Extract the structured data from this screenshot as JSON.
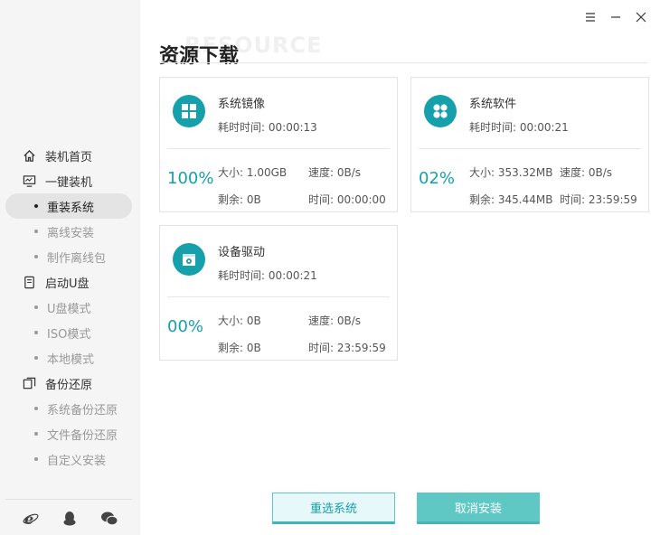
{
  "window": {
    "controls": [
      "menu",
      "minimize",
      "close"
    ]
  },
  "header": {
    "background_word": "RESOURCE",
    "title": "资源下载"
  },
  "sidebar": {
    "groups": [
      {
        "label": "装机首页",
        "icon": "home-icon",
        "items": []
      },
      {
        "label": "一键装机",
        "icon": "monitor-icon",
        "items": [
          {
            "label": "重装系统",
            "active": true
          },
          {
            "label": "离线安装"
          },
          {
            "label": "制作离线包"
          }
        ]
      },
      {
        "label": "启动U盘",
        "icon": "usb-drive-icon",
        "items": [
          {
            "label": "U盘模式"
          },
          {
            "label": "ISO模式"
          },
          {
            "label": "本地模式"
          }
        ]
      },
      {
        "label": "备份还原",
        "icon": "backup-icon",
        "items": [
          {
            "label": "系统备份还原"
          },
          {
            "label": "文件备份还原"
          },
          {
            "label": "自定义安装"
          }
        ]
      }
    ],
    "footer_icons": [
      "ie-browser-icon",
      "qq-penguin-icon",
      "wechat-icon"
    ]
  },
  "cards": [
    {
      "name": "系统镜像",
      "icon": "windows-logo-icon",
      "time_label": "耗时时间:",
      "time": "00:00:13",
      "percent": "100%",
      "size_label": "大小:",
      "size": "1.00GB",
      "speed_label": "速度:",
      "speed": "0B/s",
      "remain_label": "剩余:",
      "remain": "0B",
      "eta_label": "时间:",
      "eta": "00:00:00"
    },
    {
      "name": "系统软件",
      "icon": "apps-grid-icon",
      "time_label": "耗时时间:",
      "time": "00:00:21",
      "percent": "02%",
      "size_label": "大小:",
      "size": "353.32MB",
      "speed_label": "速度:",
      "speed": "0B/s",
      "remain_label": "剩余:",
      "remain": "345.44MB",
      "eta_label": "时间:",
      "eta": "23:59:59"
    },
    {
      "name": "设备驱动",
      "icon": "driver-icon",
      "time_label": "耗时时间:",
      "time": "00:00:21",
      "percent": "00%",
      "size_label": "大小:",
      "size": "0B",
      "speed_label": "速度:",
      "speed": "0B/s",
      "remain_label": "剩余:",
      "remain": "0B",
      "eta_label": "时间:",
      "eta": "23:59:59"
    }
  ],
  "buttons": {
    "reselect": "重选系统",
    "cancel": "取消安装"
  },
  "colors": {
    "accent": "#16a0ab",
    "cancel_button": "#5fc8c5",
    "sidebar_bg": "#f5f5f5"
  }
}
